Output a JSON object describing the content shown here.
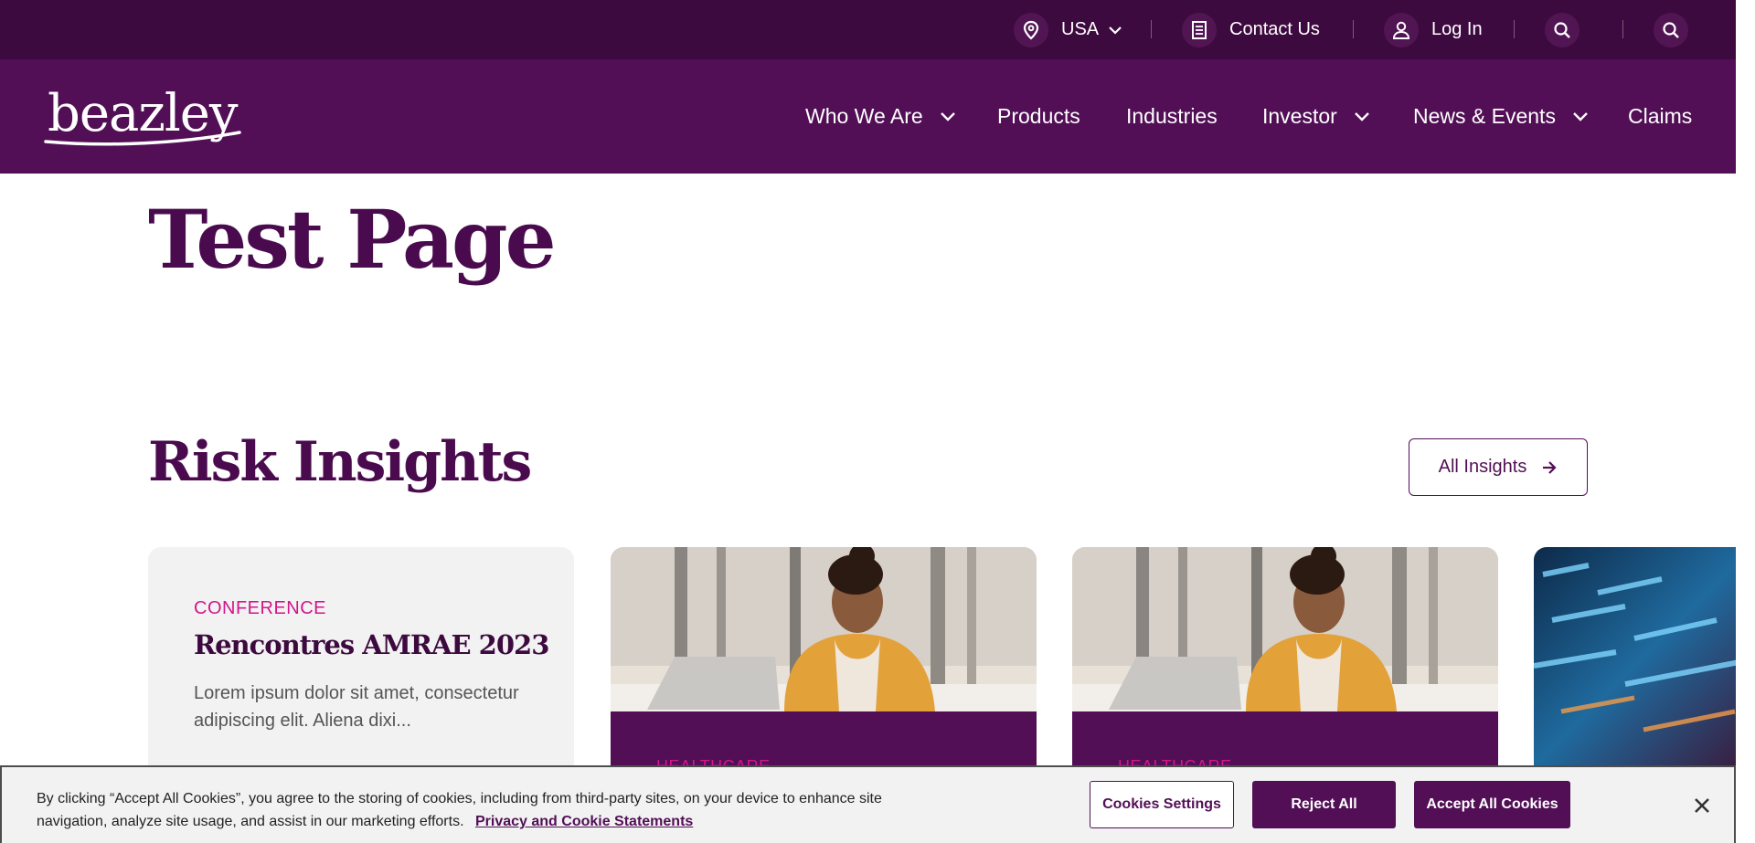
{
  "utility_bar": {
    "region_label": "USA",
    "contact_label": "Contact Us",
    "login_label": "Log In",
    "separator": "|"
  },
  "brand": {
    "logo_text": "beazley",
    "colors": {
      "primary": "#520f56",
      "dark": "#3d0a3f",
      "accent": "#d1178b"
    }
  },
  "nav": {
    "items": [
      {
        "label": "Who We Are",
        "has_dropdown": true
      },
      {
        "label": "Products",
        "has_dropdown": false
      },
      {
        "label": "Industries",
        "has_dropdown": false
      },
      {
        "label": "Investor",
        "has_dropdown": true
      },
      {
        "label": "News & Events",
        "has_dropdown": true
      },
      {
        "label": "Claims",
        "has_dropdown": false
      }
    ]
  },
  "page": {
    "title": "Test Page"
  },
  "insights": {
    "title": "Risk Insights",
    "all_label": "All Insights",
    "cards": [
      {
        "eyebrow": "CONFERENCE",
        "title": "Rencontres AMRAE 2023",
        "body": "Lorem ipsum dolor sit amet, consectetur adipiscing elit. Aliena dixi..."
      },
      {
        "eyebrow": "HEALTHCARE",
        "image": "woman-with-laptop-photo"
      },
      {
        "eyebrow": "HEALTHCARE",
        "image": "woman-with-laptop-photo"
      },
      {
        "image": "digital-data-photo"
      }
    ]
  },
  "cookie_banner": {
    "text": "By clicking “Accept All Cookies”, you agree to the storing of cookies, including from third-party sites, on your device to enhance site navigation, analyze site usage, and assist in our marketing efforts.",
    "link_label": "Privacy and Cookie Statements",
    "settings_label": "Cookies Settings",
    "reject_label": "Reject All",
    "accept_label": "Accept All Cookies"
  }
}
